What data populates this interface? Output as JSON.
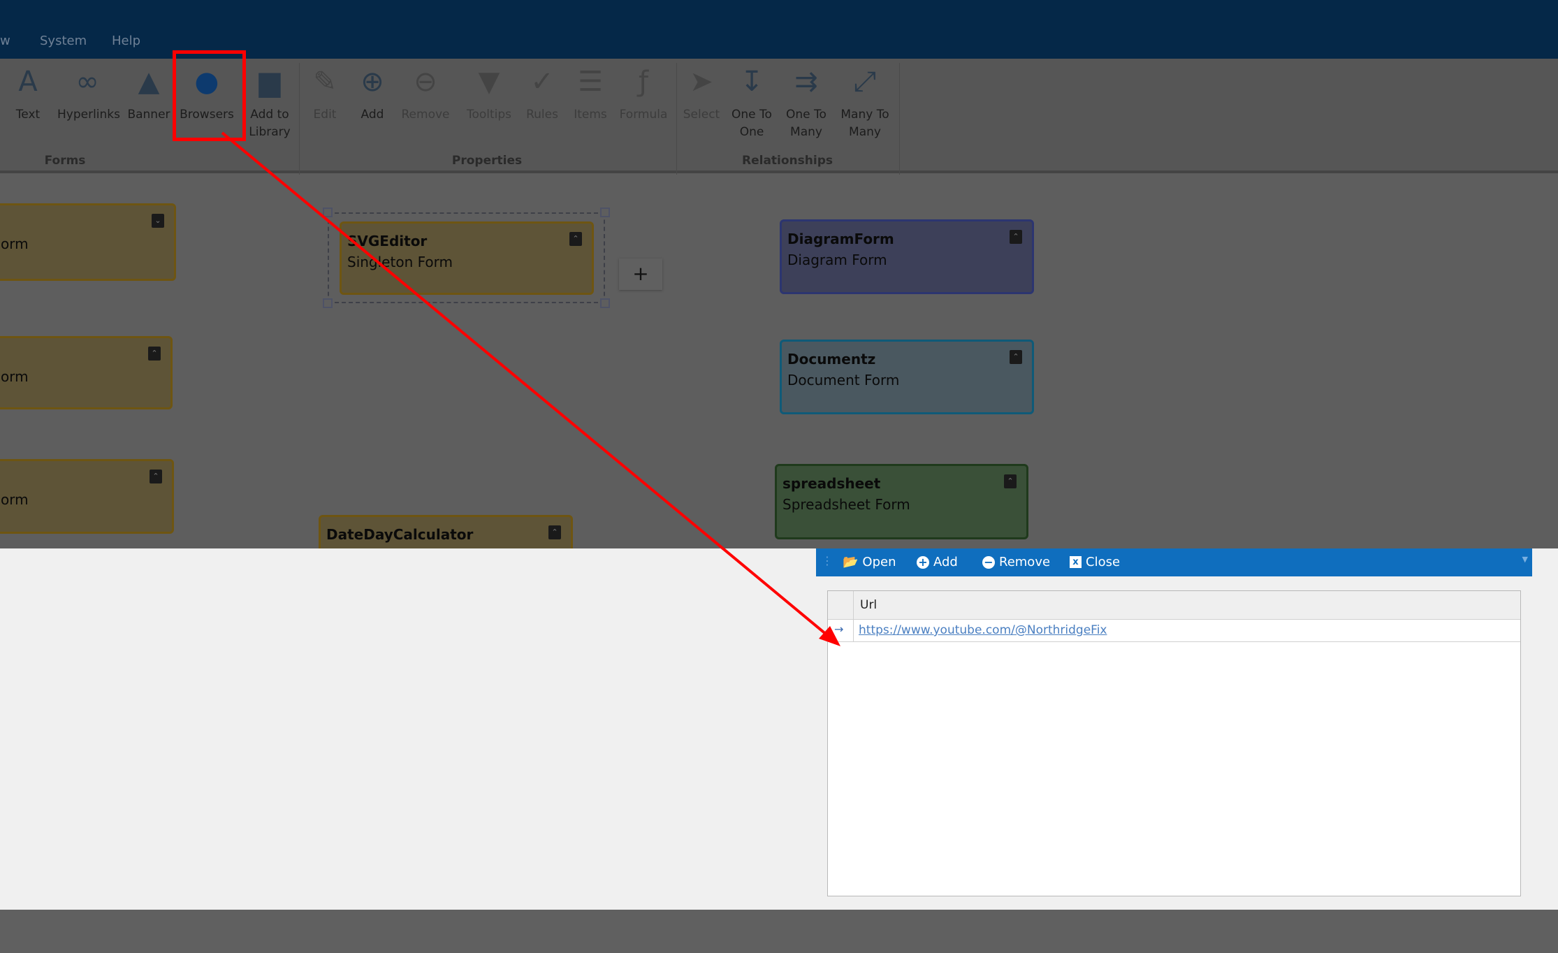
{
  "menu": {
    "partial": "w",
    "system": "System",
    "help": "Help"
  },
  "ribbon": {
    "buttons": [
      {
        "label": "Text",
        "icon": "text-icon"
      },
      {
        "label": "Hyperlinks",
        "icon": "link-icon"
      },
      {
        "label": "Banner",
        "icon": "image-icon"
      },
      {
        "label": "Browsers",
        "icon": "globe-icon"
      },
      {
        "label": "Add to Library",
        "icon": "folder-add-icon"
      },
      {
        "label": "Edit",
        "icon": "edit-icon"
      },
      {
        "label": "Add",
        "icon": "add-icon"
      },
      {
        "label": "Remove",
        "icon": "remove-icon"
      },
      {
        "label": "Tooltips",
        "icon": "tooltip-icon"
      },
      {
        "label": "Rules",
        "icon": "rules-icon"
      },
      {
        "label": "Items",
        "icon": "items-icon"
      },
      {
        "label": "Formula",
        "icon": "formula-icon"
      },
      {
        "label": "Select",
        "icon": "cursor-icon"
      },
      {
        "label": "One To One",
        "icon": "one-to-one-icon"
      },
      {
        "label": "One To Many",
        "icon": "one-to-many-icon"
      },
      {
        "label": "Many To Many",
        "icon": "many-to-many-icon"
      }
    ],
    "groups": {
      "forms": "Forms",
      "properties": "Properties",
      "relationships": "Relationships"
    }
  },
  "canvas": {
    "cards": [
      {
        "subtitle": "orm"
      },
      {
        "subtitle": "orm"
      },
      {
        "subtitle": "orm"
      },
      {
        "title": "SVGEditor",
        "subtitle": "Singleton Form"
      },
      {
        "title": "DateDayCalculator"
      },
      {
        "title": "DiagramForm",
        "subtitle": "Diagram Form"
      },
      {
        "title": "Documentz",
        "subtitle": "Document Form"
      },
      {
        "title": "spreadsheet",
        "subtitle": "Spreadsheet Form"
      }
    ],
    "plus": "+"
  },
  "browsers_panel": {
    "toolbar": {
      "open": "Open",
      "add": "Add",
      "remove": "Remove",
      "close": "Close"
    },
    "grid": {
      "header": "Url",
      "rows": [
        {
          "url": "https://www.youtube.com/@NorthridgeFix"
        }
      ]
    }
  },
  "colors": {
    "accent": "#0f6ebe",
    "highlight": "#ff0000"
  }
}
